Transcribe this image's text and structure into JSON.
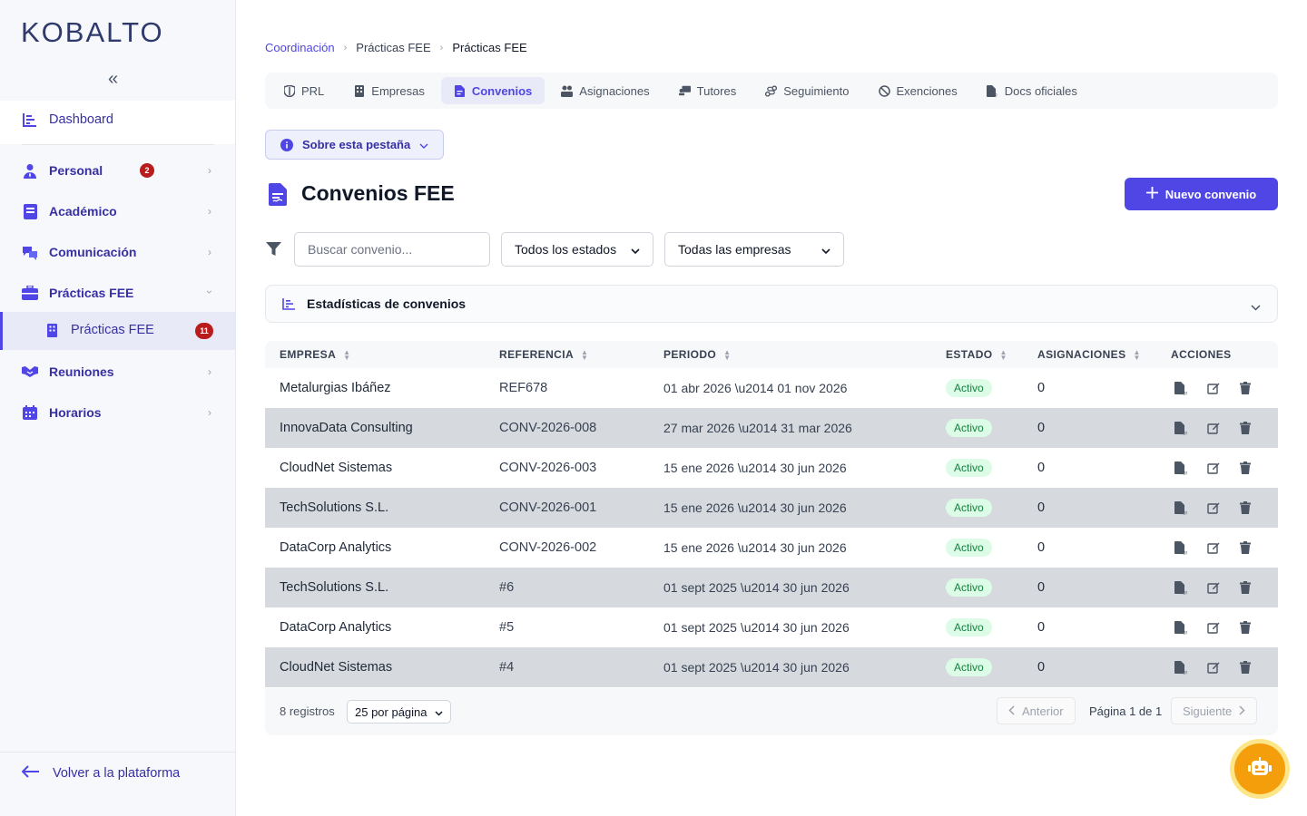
{
  "brand": {
    "logo": "KOBALTO",
    "collapse": "«"
  },
  "sidebar": {
    "dashboard": "Dashboard",
    "items": [
      {
        "label": "Personal",
        "badge": "2"
      },
      {
        "label": "Académico"
      },
      {
        "label": "Comunicación"
      },
      {
        "label": "Prácticas FEE"
      },
      {
        "label": "Reuniones"
      },
      {
        "label": "Horarios"
      }
    ],
    "sub_item": {
      "label": "Prácticas FEE",
      "badge": "11"
    },
    "back": "Volver a la plataforma"
  },
  "breadcrumb": [
    "Coordinación",
    "Prácticas FEE",
    "Prácticas FEE"
  ],
  "tabs": [
    "PRL",
    "Empresas",
    "Convenios",
    "Asignaciones",
    "Tutores",
    "Seguimiento",
    "Exenciones",
    "Docs oficiales"
  ],
  "about": "Sobre esta pestaña",
  "page": {
    "title": "Convenios FEE",
    "new_button": "Nuevo convenio"
  },
  "filters": {
    "search_placeholder": "Buscar convenio...",
    "status": "Todos los estados",
    "company": "Todas las empresas"
  },
  "stats": {
    "label": "Estadísticas de convenios"
  },
  "table": {
    "headers": [
      "EMPRESA",
      "REFERENCIA",
      "PERIODO",
      "ESTADO",
      "ASIGNACIONES",
      "ACCIONES"
    ],
    "rows": [
      {
        "empresa": "Metalurgias Ibáñez",
        "ref": "REF678",
        "periodo": "01 abr 2026 \\u2014 01 nov 2026",
        "estado": "Activo",
        "asig": "0"
      },
      {
        "empresa": "InnovaData Consulting",
        "ref": "CONV-2026-008",
        "periodo": "27 mar 2026 \\u2014 31 mar 2026",
        "estado": "Activo",
        "asig": "0"
      },
      {
        "empresa": "CloudNet Sistemas",
        "ref": "CONV-2026-003",
        "periodo": "15 ene 2026 \\u2014 30 jun 2026",
        "estado": "Activo",
        "asig": "0"
      },
      {
        "empresa": "TechSolutions S.L.",
        "ref": "CONV-2026-001",
        "periodo": "15 ene 2026 \\u2014 30 jun 2026",
        "estado": "Activo",
        "asig": "0"
      },
      {
        "empresa": "DataCorp Analytics",
        "ref": "CONV-2026-002",
        "periodo": "15 ene 2026 \\u2014 30 jun 2026",
        "estado": "Activo",
        "asig": "0"
      },
      {
        "empresa": "TechSolutions S.L.",
        "ref": "#6",
        "periodo": "01 sept 2025 \\u2014 30 jun 2026",
        "estado": "Activo",
        "asig": "0"
      },
      {
        "empresa": "DataCorp Analytics",
        "ref": "#5",
        "periodo": "01 sept 2025 \\u2014 30 jun 2026",
        "estado": "Activo",
        "asig": "0"
      },
      {
        "empresa": "CloudNet Sistemas",
        "ref": "#4",
        "periodo": "01 sept 2025 \\u2014 30 jun 2026",
        "estado": "Activo",
        "asig": "0"
      }
    ]
  },
  "footer": {
    "count": "8 registros",
    "per_page": "25 por página",
    "prev": "Anterior",
    "page_info": "Página 1 de 1",
    "next": "Siguiente"
  },
  "colors": {
    "accent": "#4f46e5",
    "sidebar_text": "#3730a3",
    "active_green": "#15803d",
    "bot": "#f59e0b"
  },
  "icons": {
    "dashboard": "chart-bars-icon",
    "personal": "user-tie-icon",
    "academico": "book-icon",
    "comunicacion": "chat-icon",
    "practicas": "briefcase-icon",
    "reuniones": "handshake-icon",
    "horarios": "calendar-icon",
    "bot": "robot-icon"
  }
}
